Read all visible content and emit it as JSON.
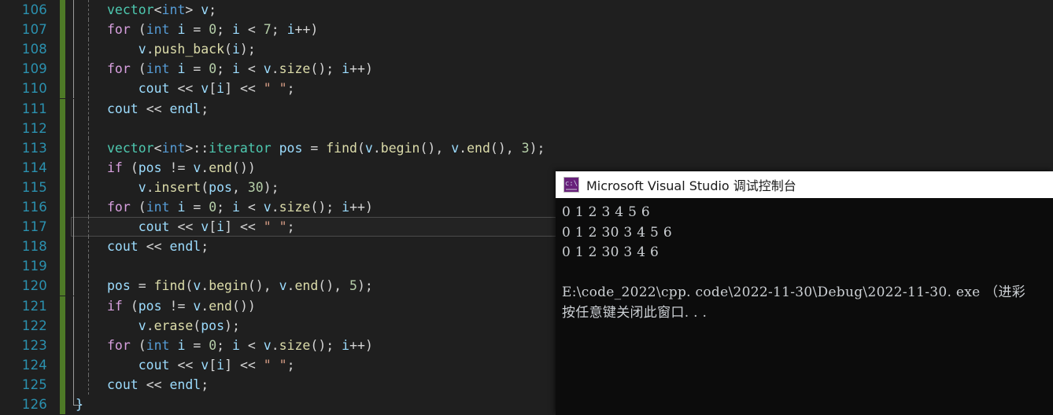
{
  "editor": {
    "first_line_number": 106,
    "current_line_number": 117,
    "lines": [
      {
        "n": "106",
        "indent": 0,
        "text": "vector<int> v;"
      },
      {
        "n": "107",
        "indent": 0,
        "text": "for (int i = 0; i < 7; i++)"
      },
      {
        "n": "108",
        "indent": 1,
        "text": "v.push_back(i);"
      },
      {
        "n": "109",
        "indent": 0,
        "text": "for (int i = 0; i < v.size(); i++)"
      },
      {
        "n": "110",
        "indent": 1,
        "text": "cout << v[i] << \" \";"
      },
      {
        "n": "111",
        "indent": 0,
        "text": "cout << endl;"
      },
      {
        "n": "112",
        "indent": 0,
        "text": ""
      },
      {
        "n": "113",
        "indent": 0,
        "text": "vector<int>::iterator pos = find(v.begin(), v.end(), 3);"
      },
      {
        "n": "114",
        "indent": 0,
        "text": "if (pos != v.end())"
      },
      {
        "n": "115",
        "indent": 1,
        "text": "v.insert(pos, 30);"
      },
      {
        "n": "116",
        "indent": 0,
        "text": "for (int i = 0; i < v.size(); i++)"
      },
      {
        "n": "117",
        "indent": 1,
        "text": "cout << v[i] << \" \";"
      },
      {
        "n": "118",
        "indent": 0,
        "text": "cout << endl;"
      },
      {
        "n": "119",
        "indent": 0,
        "text": ""
      },
      {
        "n": "120",
        "indent": 0,
        "text": "pos = find(v.begin(), v.end(), 5);"
      },
      {
        "n": "121",
        "indent": 0,
        "text": "if (pos != v.end())"
      },
      {
        "n": "122",
        "indent": 1,
        "text": "v.erase(pos);"
      },
      {
        "n": "123",
        "indent": 0,
        "text": "for (int i = 0; i < v.size(); i++)"
      },
      {
        "n": "124",
        "indent": 1,
        "text": "cout << v[i] << \" \";"
      },
      {
        "n": "125",
        "indent": 0,
        "text": "cout << endl;"
      },
      {
        "n": "126",
        "indent": -1,
        "text": "}"
      }
    ],
    "colors": {
      "background": "#1f1f1f",
      "line_number": "#2b91af",
      "change_bar": "#4e7a27",
      "keyword": "#d8a0df",
      "type": "#4ec9b0",
      "identifier": "#9cdcfe",
      "function": "#dcdcaa",
      "number": "#b5cea8",
      "string": "#d69d85",
      "operator": "#d4d4d4"
    }
  },
  "console": {
    "title": "Microsoft Visual Studio 调试控制台",
    "icon_name": "console-icon",
    "icon_glyph": "c:\\",
    "output_lines": [
      "0 1 2 3 4 5 6",
      "0 1 2 30 3 4 5 6",
      "0 1 2 30 3 4 6"
    ],
    "exit_path_line": "E:\\code_2022\\cpp. code\\2022-11-30\\Debug\\2022-11-30. exe （进彩",
    "prompt_line": "按任意键关闭此窗口. . .",
    "colors": {
      "titlebar_background": "#ffffff",
      "titlebar_text": "#1a1a1a",
      "body_background": "#0c0c0c",
      "body_text": "#ccd0d4",
      "icon_background": "#68217a"
    }
  }
}
